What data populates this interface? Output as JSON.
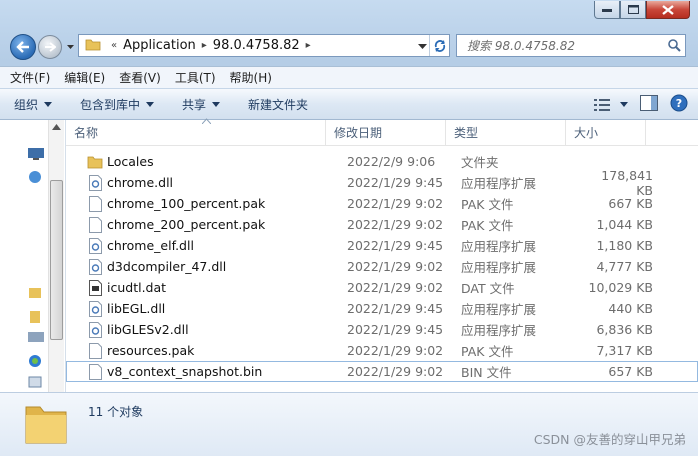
{
  "address": {
    "crumb_prefix": "«",
    "crumbs": [
      "Application",
      "98.0.4758.82"
    ]
  },
  "search": {
    "placeholder": "搜索 98.0.4758.82"
  },
  "menubar": {
    "items": [
      "文件(F)",
      "编辑(E)",
      "查看(V)",
      "工具(T)",
      "帮助(H)"
    ]
  },
  "commandbar": {
    "organize": "组织",
    "include_library": "包含到库中",
    "share": "共享",
    "new_folder": "新建文件夹"
  },
  "columns": {
    "name": "名称",
    "date": "修改日期",
    "type": "类型",
    "size": "大小"
  },
  "files": [
    {
      "name": "Locales",
      "date": "2022/2/9 9:06",
      "type": "文件夹",
      "size": "",
      "icon": "folder-icon"
    },
    {
      "name": "chrome.dll",
      "date": "2022/1/29 9:45",
      "type": "应用程序扩展",
      "size": "178,841 KB",
      "icon": "dll-file-icon"
    },
    {
      "name": "chrome_100_percent.pak",
      "date": "2022/1/29 9:02",
      "type": "PAK 文件",
      "size": "667 KB",
      "icon": "generic-file-icon"
    },
    {
      "name": "chrome_200_percent.pak",
      "date": "2022/1/29 9:02",
      "type": "PAK 文件",
      "size": "1,044 KB",
      "icon": "generic-file-icon"
    },
    {
      "name": "chrome_elf.dll",
      "date": "2022/1/29 9:45",
      "type": "应用程序扩展",
      "size": "1,180 KB",
      "icon": "dll-file-icon"
    },
    {
      "name": "d3dcompiler_47.dll",
      "date": "2022/1/29 9:02",
      "type": "应用程序扩展",
      "size": "4,777 KB",
      "icon": "dll-file-icon"
    },
    {
      "name": "icudtl.dat",
      "date": "2022/1/29 9:02",
      "type": "DAT 文件",
      "size": "10,029 KB",
      "icon": "dat-file-icon"
    },
    {
      "name": "libEGL.dll",
      "date": "2022/1/29 9:45",
      "type": "应用程序扩展",
      "size": "440 KB",
      "icon": "dll-file-icon"
    },
    {
      "name": "libGLESv2.dll",
      "date": "2022/1/29 9:45",
      "type": "应用程序扩展",
      "size": "6,836 KB",
      "icon": "dll-file-icon"
    },
    {
      "name": "resources.pak",
      "date": "2022/1/29 9:02",
      "type": "PAK 文件",
      "size": "7,317 KB",
      "icon": "generic-file-icon"
    },
    {
      "name": "v8_context_snapshot.bin",
      "date": "2022/1/29 9:02",
      "type": "BIN 文件",
      "size": "657 KB",
      "icon": "generic-file-icon"
    }
  ],
  "details": {
    "item_count": "11 个对象"
  },
  "watermark": "CSDN @友善的穿山甲兄弟",
  "colors": {
    "folder": "#e8c25a",
    "accent": "#2b6cb6",
    "close": "#c9473a"
  }
}
